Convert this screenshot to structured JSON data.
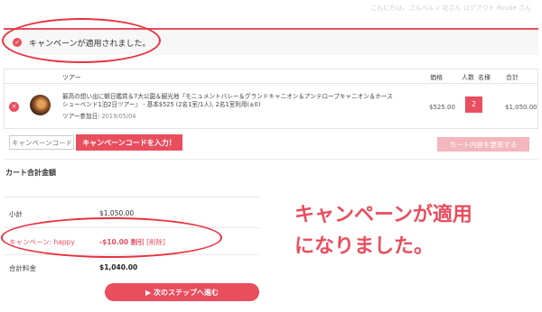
{
  "top_greeting": "こんにちは、ゴルベルン 花さん ログアウト Ryude さん",
  "notice": {
    "icon": "check-icon",
    "text": "キャンペーンが適用されました。"
  },
  "table": {
    "headers": {
      "tour": "ツアー",
      "price": "価格",
      "people": "人数",
      "name": "名様",
      "total": "合計"
    },
    "item": {
      "remove_icon": "close-icon",
      "name": "最高の想い出に朝日鑑賞＆7大公園＆観光地『モニュメントバレー＆グランドキャニオン＆アンテロープキャニオン＆ホースシューベンド1泊2日ツアー』 - 基本$525 (2名1室/1人), 2名1室利用(±0)",
      "date_label": "ツアー参加日:",
      "date_value": "2019/05/04",
      "price": "$525.00",
      "quantity": "2",
      "total": "$1,050.00"
    }
  },
  "coupon": {
    "placeholder": "キャンペーンコード",
    "apply_label": "キャンペーンコードを入力！"
  },
  "update_cart_label": "カート内容を更新する",
  "totals": {
    "title": "カート合計金額",
    "subtotal_label": "小計",
    "subtotal_value": "$1,050.00",
    "coupon_label": "キャンペーン: happy",
    "coupon_discount": "-$10.00 割引",
    "coupon_remove": "[削除]",
    "grand_label": "合計料金",
    "grand_value": "$1,040.00"
  },
  "next_button_label": "▶ 次のステップへ進む",
  "caption": {
    "line1": "キャンペーンが適用",
    "line2": "になりました。"
  },
  "colors": {
    "accent": "#e94e5e",
    "annotation": "#e8323f"
  }
}
